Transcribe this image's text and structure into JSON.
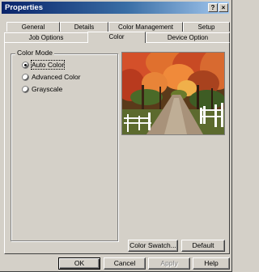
{
  "window": {
    "title": "Properties",
    "help_icon": "?",
    "close_icon": "×"
  },
  "tabs_back": [
    "General",
    "Details",
    "Color Management",
    "Setup"
  ],
  "tabs_front": [
    "Job Options",
    "Color",
    "Device Option"
  ],
  "active_tab": "Color",
  "color_mode": {
    "group_label": "Color Mode",
    "options": [
      "Auto Color",
      "Advanced Color",
      "Grayscale"
    ],
    "selected": "Auto Color"
  },
  "panel_buttons": {
    "color_swatch": "Color Swatch...",
    "default": "Default"
  },
  "dialog_buttons": {
    "ok": "OK",
    "cancel": "Cancel",
    "apply": "Apply",
    "help": "Help"
  },
  "colors": {
    "face": "#d4d0c8",
    "title_start": "#0a246a",
    "title_end": "#a6caf0"
  }
}
